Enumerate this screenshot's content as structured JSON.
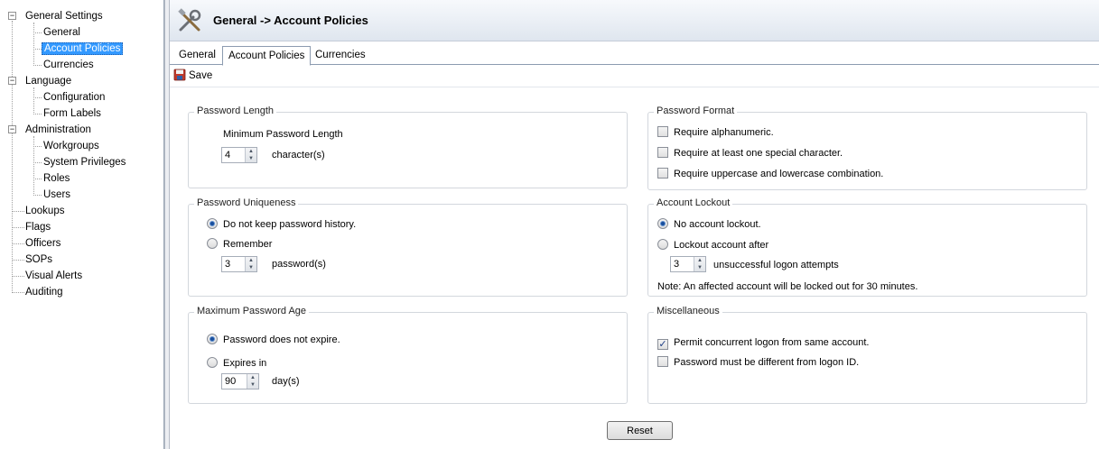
{
  "tree": {
    "general_settings": "General Settings",
    "general": "General",
    "account_policies": "Account Policies",
    "currencies": "Currencies",
    "language": "Language",
    "configuration": "Configuration",
    "form_labels": "Form Labels",
    "administration": "Administration",
    "workgroups": "Workgroups",
    "system_privileges": "System Privileges",
    "roles": "Roles",
    "users": "Users",
    "lookups": "Lookups",
    "flags": "Flags",
    "officers": "Officers",
    "sops": "SOPs",
    "visual_alerts": "Visual Alerts",
    "auditing": "Auditing",
    "selected": "Account Policies"
  },
  "header": {
    "title": "General  -> Account Policies",
    "icon": "tools-icon"
  },
  "tabs": [
    "General",
    "Account Policies",
    "Currencies"
  ],
  "active_tab": "Account Policies",
  "toolbar": {
    "save_label": "Save"
  },
  "password_length": {
    "title": "Password Length",
    "min_label": "Minimum Password Length",
    "value": "4",
    "unit": "character(s)"
  },
  "password_uniqueness": {
    "title": "Password Uniqueness",
    "option_no_history": "Do not keep password history.",
    "option_remember": "Remember",
    "selected": "Do not keep password history.",
    "value": "3",
    "unit": "password(s)"
  },
  "max_password_age": {
    "title": "Maximum Password Age",
    "option_no_expire": "Password does not expire.",
    "option_expires": "Expires in",
    "selected": "Password does not expire.",
    "value": "90",
    "unit": "day(s)"
  },
  "password_format": {
    "title": "Password Format",
    "alphanumeric": "Require alphanumeric.",
    "special_char": "Require at least one special character.",
    "case_combo": "Require uppercase and lowercase combination.",
    "alphanumeric_checked": false,
    "special_char_checked": false,
    "case_combo_checked": false
  },
  "account_lockout": {
    "title": "Account Lockout",
    "option_none": "No account lockout.",
    "option_lockout": "Lockout account after",
    "selected": "No account lockout.",
    "value": "3",
    "unit": "unsuccessful logon attempts",
    "note": "Note: An affected account will be locked out for 30 minutes."
  },
  "miscellaneous": {
    "title": "Miscellaneous",
    "concurrent": "Permit concurrent logon from same account.",
    "different_from_id": "Password must be different from logon ID.",
    "concurrent_checked": true,
    "different_checked": false
  },
  "reset_label": "Reset",
  "colors": {
    "selection": "#3399ff",
    "header_gradient_top": "#f7f9fc",
    "header_gradient_bottom": "#dfe6ef"
  }
}
